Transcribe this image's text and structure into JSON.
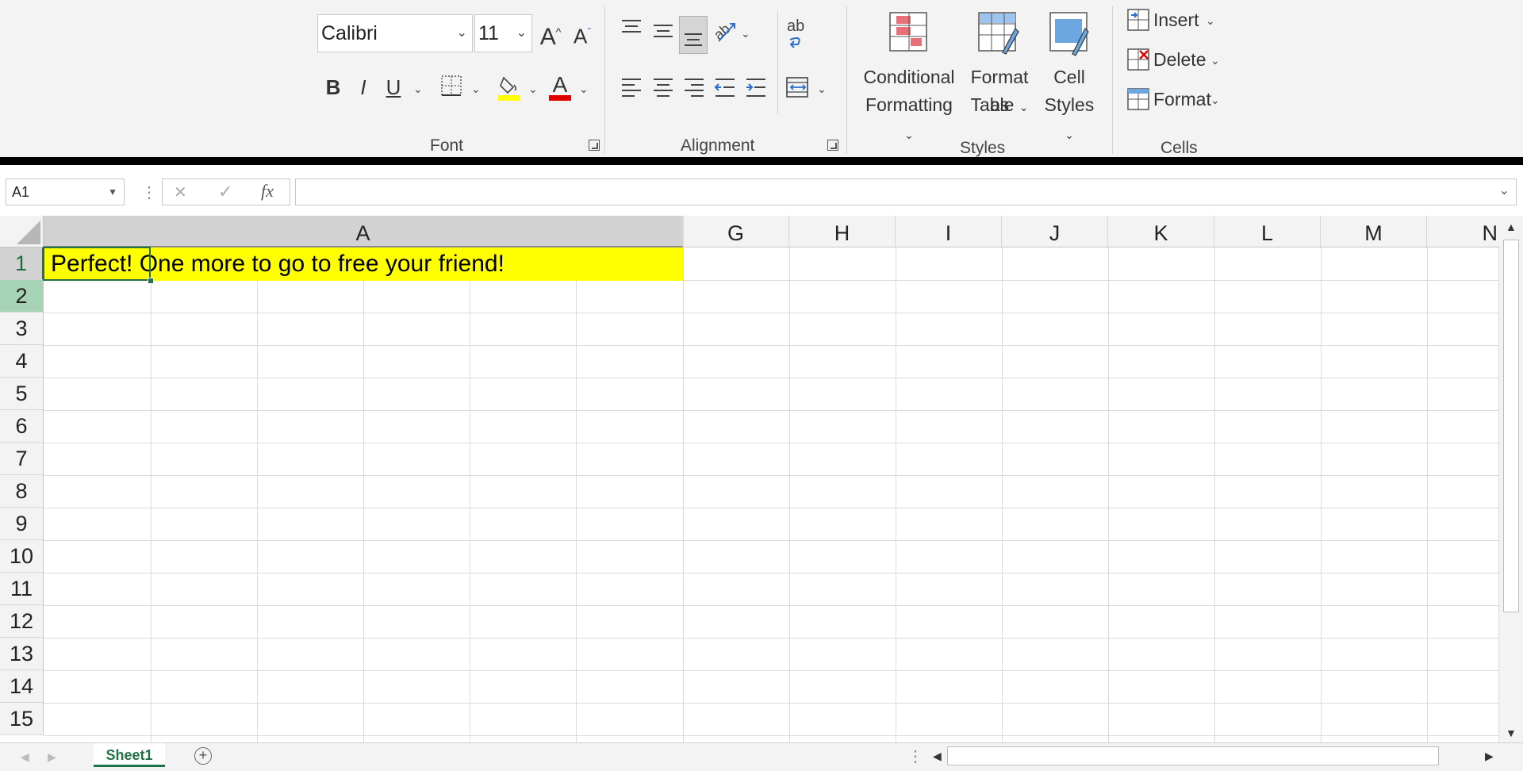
{
  "ribbon": {
    "font": {
      "family_value": "Calibri",
      "size_value": "11",
      "bold_label": "B",
      "italic_label": "I",
      "underline_label": "U",
      "grow_label": "A",
      "shrink_label": "A",
      "font_color_label": "A",
      "group_label": "Font",
      "fill_color": "#ffff00",
      "font_color": "#e00000"
    },
    "alignment": {
      "wrap_label": "ab",
      "group_label": "Alignment"
    },
    "styles": {
      "conditional_line1": "Conditional",
      "conditional_line2": "Formatting",
      "format_table_line1": "Format as",
      "format_table_line2": "Table",
      "cell_styles_line1": "Cell",
      "cell_styles_line2": "Styles",
      "group_label": "Styles"
    },
    "cells": {
      "insert_label": "Insert",
      "delete_label": "Delete",
      "format_label": "Format",
      "group_label": "Cells"
    }
  },
  "formula_bar": {
    "name_box": "A1",
    "cancel_icon": "✕",
    "enter_icon": "✓",
    "fx_label": "fx",
    "formula_value": ""
  },
  "grid": {
    "columns": [
      "A",
      "G",
      "H",
      "I",
      "J",
      "K",
      "L",
      "M",
      "N"
    ],
    "rows": [
      "1",
      "2",
      "3",
      "4",
      "5",
      "6",
      "7",
      "8",
      "9",
      "10",
      "11",
      "12",
      "13",
      "14",
      "15"
    ],
    "selected_cell": "A1",
    "cell_a1": "Perfect! One more to go to free your friend!",
    "highlight_color": "#ffff00"
  },
  "sheets": {
    "active_tab": "Sheet1"
  }
}
